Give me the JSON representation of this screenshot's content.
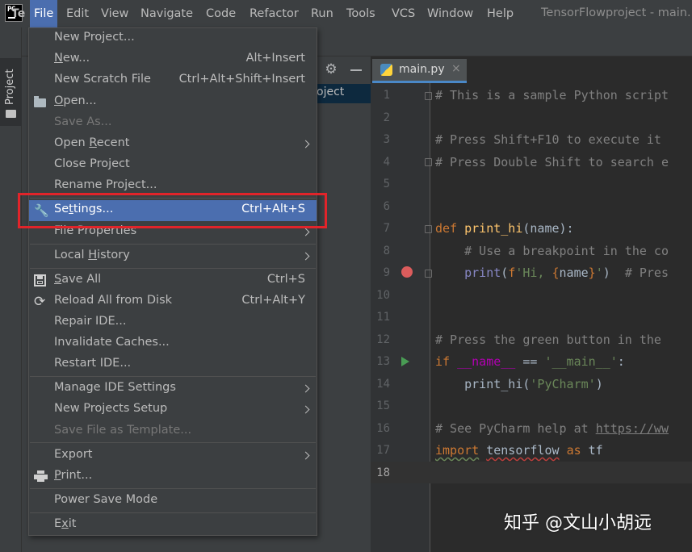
{
  "app": {
    "logo_text": "PC",
    "window_title": "TensorFlowproject - main.",
    "menu": [
      "File",
      "Edit",
      "View",
      "Navigate",
      "Code",
      "Refactor",
      "Run",
      "Tools",
      "VCS",
      "Window",
      "Help"
    ],
    "active_menu": "File"
  },
  "toolwindow": {
    "tab_label": "Project",
    "header_title": "Te",
    "root_fragment": "oject"
  },
  "editor": {
    "tab_label": "main.py",
    "tab_close": "×",
    "current_line": 18,
    "line_numbers": [
      "1",
      "2",
      "3",
      "4",
      "5",
      "6",
      "7",
      "8",
      "9",
      "10",
      "11",
      "12",
      "13",
      "14",
      "15",
      "16",
      "17",
      "18"
    ],
    "lines": [
      "# This is a sample Python script",
      "",
      "# Press Shift+F10 to execute it",
      "# Press Double Shift to search e",
      "",
      "",
      "def print_hi(name):",
      "    # Use a breakpoint in the co",
      "    print(f'Hi, {name}')  # Pres",
      "",
      "",
      "# Press the green button in the",
      "if __name__ == '__main__':",
      "    print_hi('PyCharm')",
      "",
      "# See PyCharm help at https://ww",
      "import tensorflow as tf",
      ""
    ]
  },
  "file_menu": {
    "items": [
      {
        "label": "New Project...",
        "shortcut": ""
      },
      {
        "label": "New...",
        "shortcut": "Alt+Insert"
      },
      {
        "label": "New Scratch File",
        "shortcut": "Ctrl+Alt+Shift+Insert"
      },
      {
        "label": "Open...",
        "shortcut": "",
        "icon": "folder-icon"
      },
      {
        "label": "Save As...",
        "shortcut": "",
        "disabled": true
      },
      {
        "label": "Open Recent",
        "shortcut": "",
        "submenu": true
      },
      {
        "label": "Close Project",
        "shortcut": ""
      },
      {
        "label": "Rename Project...",
        "shortcut": ""
      },
      {
        "label": "Settings...",
        "shortcut": "Ctrl+Alt+S",
        "icon": "wrench-icon",
        "selected": true
      },
      {
        "label": "File Properties",
        "shortcut": "",
        "submenu": true
      },
      {
        "label": "Local History",
        "shortcut": "",
        "submenu": true
      },
      {
        "label": "Save All",
        "shortcut": "Ctrl+S",
        "icon": "save-icon"
      },
      {
        "label": "Reload All from Disk",
        "shortcut": "Ctrl+Alt+Y",
        "icon": "reload-icon"
      },
      {
        "label": "Repair IDE...",
        "shortcut": ""
      },
      {
        "label": "Invalidate Caches...",
        "shortcut": ""
      },
      {
        "label": "Restart IDE...",
        "shortcut": ""
      },
      {
        "label": "Manage IDE Settings",
        "shortcut": "",
        "submenu": true
      },
      {
        "label": "New Projects Setup",
        "shortcut": "",
        "submenu": true
      },
      {
        "label": "Save File as Template...",
        "shortcut": "",
        "disabled": true
      },
      {
        "label": "Export",
        "shortcut": "",
        "submenu": true
      },
      {
        "label": "Print...",
        "shortcut": "",
        "icon": "print-icon"
      },
      {
        "label": "Power Save Mode",
        "shortcut": ""
      },
      {
        "label": "Exit",
        "shortcut": ""
      }
    ]
  },
  "watermark": "知乎 @文山小胡远",
  "colors": {
    "background": "#2b2b2b",
    "menubar": "#3c3f41",
    "selection": "#4b6eaf",
    "annotation": "#e1242a",
    "keyword": "#cc7832",
    "function": "#ffc66d",
    "string": "#6a8759",
    "comment": "#808080"
  }
}
